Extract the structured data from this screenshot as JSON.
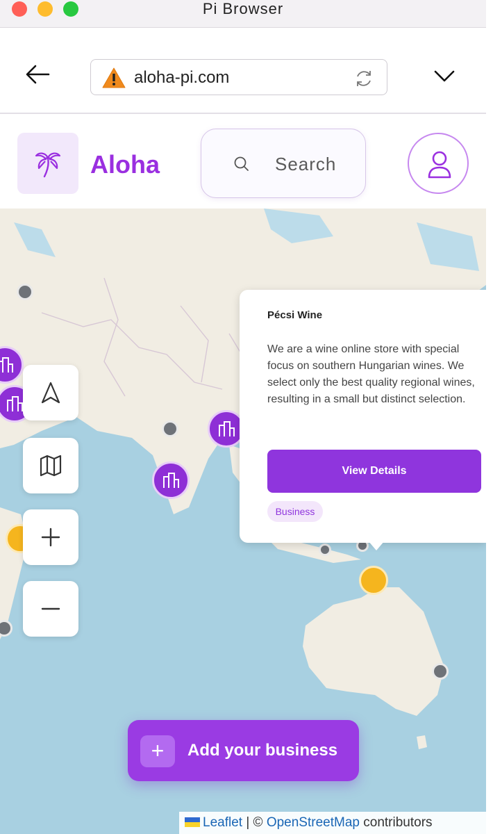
{
  "window": {
    "title": "Pi Browser"
  },
  "browser": {
    "url": "aloha-pi.com"
  },
  "header": {
    "brand": "Aloha",
    "search_placeholder": "Search"
  },
  "popup": {
    "title": "Pécsi Wine",
    "description": "We are a wine online store with special focus on southern Hungarian wines. We select only the best quality regional wines, resulting in a small but distinct selection.",
    "button_label": "View Details",
    "tag": "Business"
  },
  "map": {
    "add_button_label": "Add your business",
    "add_button_icon": "+",
    "attribution": {
      "leaflet": "Leaflet",
      "separator": "|",
      "copyright": "©",
      "osm": "OpenStreetMap",
      "suffix": "contributors"
    },
    "controls": [
      "locate",
      "map-layers",
      "zoom-in",
      "zoom-out"
    ]
  },
  "colors": {
    "brand": "#9a2fe0",
    "button": "#8f35dd",
    "water": "#a8d0e1",
    "land": "#f1ede3",
    "marker_business": "#8e2fd6",
    "marker_generic": "#6e7278",
    "marker_featured": "#f5b51e"
  }
}
